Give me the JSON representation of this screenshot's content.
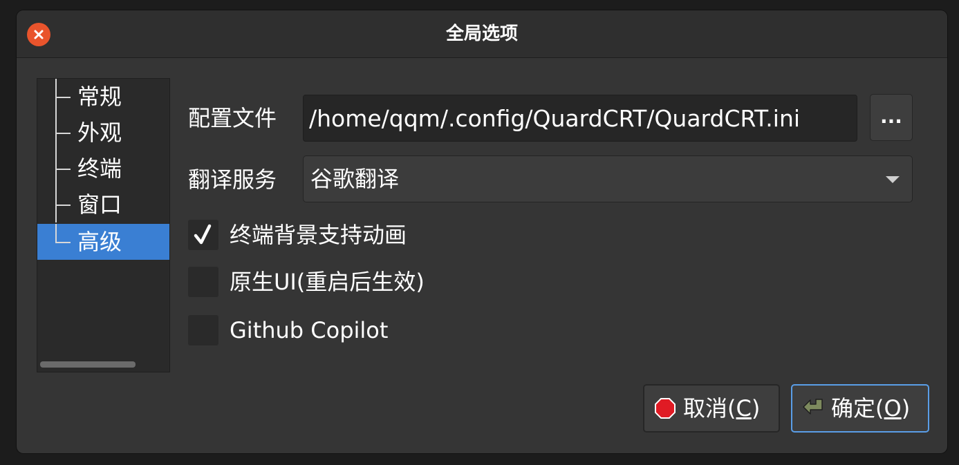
{
  "window": {
    "title": "全局选项"
  },
  "tree": {
    "items": [
      {
        "label": "常规"
      },
      {
        "label": "外观"
      },
      {
        "label": "终端"
      },
      {
        "label": "窗口"
      },
      {
        "label": "高级",
        "selected": true
      }
    ]
  },
  "config_file": {
    "label": "配置文件",
    "value": "/home/qqm/.config/QuardCRT/QuardCRT.ini",
    "browse_label": "..."
  },
  "translate_service": {
    "label": "翻译服务",
    "selected": "谷歌翻译"
  },
  "checkboxes": [
    {
      "label": "终端背景支持动画",
      "checked": true
    },
    {
      "label": "原生UI(重启后生效)",
      "checked": false
    },
    {
      "label": "Github Copilot",
      "checked": false
    }
  ],
  "buttons": {
    "cancel": {
      "prefix": "取消(",
      "mnemonic": "C",
      "suffix": ")"
    },
    "ok": {
      "prefix": "确定(",
      "mnemonic": "O",
      "suffix": ")"
    }
  },
  "colors": {
    "accent": "#3a7fd3",
    "close": "#e9542c",
    "stop_icon": "#e01b24"
  }
}
